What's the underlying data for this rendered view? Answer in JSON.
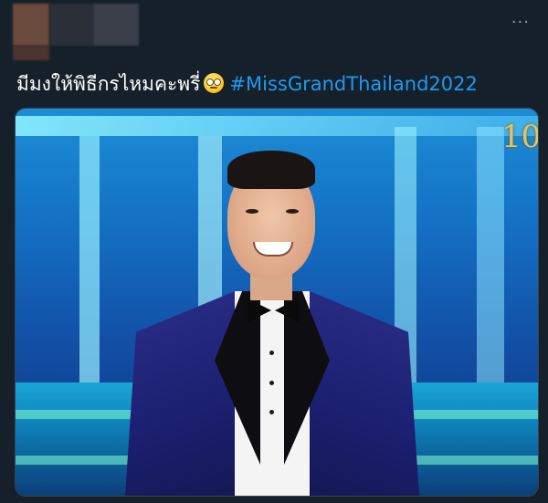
{
  "tweet": {
    "text_thai": "มีมงให้พิธีกรไหมคะพรี่",
    "emoji": "rolling-eyes-emoji",
    "hashtag": "#MissGrandThailand2022"
  },
  "header": {
    "more_icon": "more-dots-icon",
    "more_glyph": "···"
  },
  "media": {
    "logo_glyph": "10"
  },
  "colors": {
    "background": "#15202b",
    "text": "#ffffff",
    "link": "#1d9bf0",
    "muted": "#8b98a5"
  }
}
